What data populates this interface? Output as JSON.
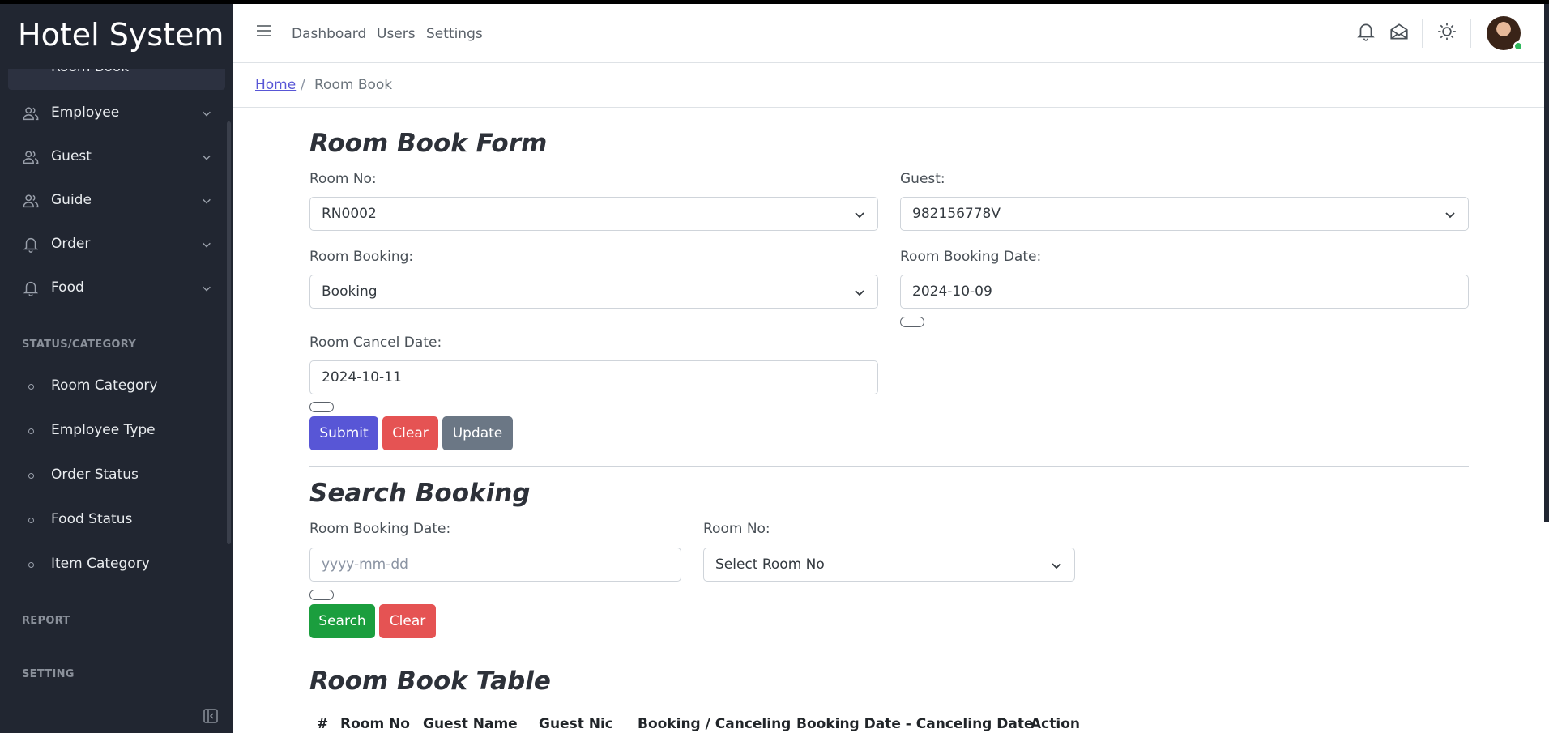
{
  "app": {
    "title": "Hotel System"
  },
  "sidebar": {
    "items": [
      {
        "label": "Room Book",
        "icon": "circle-dot-icon",
        "active": true
      },
      {
        "label": "Employee",
        "icon": "users-icon"
      },
      {
        "label": "Guest",
        "icon": "users-icon"
      },
      {
        "label": "Guide",
        "icon": "users-icon"
      },
      {
        "label": "Order",
        "icon": "bell-icon"
      },
      {
        "label": "Food",
        "icon": "bell-icon"
      }
    ],
    "section_status": "STATUS/CATEGORY",
    "status_items": [
      {
        "label": "Room Category"
      },
      {
        "label": "Employee Type"
      },
      {
        "label": "Order Status"
      },
      {
        "label": "Food Status"
      },
      {
        "label": "Item Category"
      }
    ],
    "section_report": "REPORT",
    "section_setting": "SETTING"
  },
  "header": {
    "nav": [
      "Dashboard",
      "Users",
      "Settings"
    ],
    "icons": [
      "menu-icon",
      "bell-icon",
      "envelope-icon",
      "sun-icon",
      "avatar"
    ]
  },
  "breadcrumb": {
    "home": "Home",
    "separator": "/",
    "current": "Room Book"
  },
  "form": {
    "title": "Room Book Form",
    "room_no_label": "Room No:",
    "room_no_value": "RN0002",
    "guest_label": "Guest:",
    "guest_value": "982156778V",
    "room_booking_label": "Room Booking:",
    "room_booking_value": "Booking",
    "booking_date_label": "Room Booking Date:",
    "booking_date_value": "2024-10-09",
    "cancel_date_label": "Room Cancel Date:",
    "cancel_date_value": "2024-10-11",
    "submit_label": "Submit",
    "clear_label": "Clear",
    "update_label": "Update"
  },
  "search": {
    "title": "Search Booking",
    "date_label": "Room Booking Date:",
    "date_placeholder": "yyyy-mm-dd",
    "room_label": "Room No:",
    "room_value": "Select Room No",
    "search_label": "Search",
    "clear_label": "Clear"
  },
  "table": {
    "title": "Room Book Table",
    "headers": [
      "#",
      "Room No",
      "Guest Name",
      "Guest Nic",
      "Booking / Canceling",
      "Booking Date - Canceling Date",
      "Action"
    ]
  },
  "colors": {
    "sidebar_bg": "#212631",
    "primary": "#5856d6",
    "danger": "#e55353",
    "secondary": "#6b7785",
    "success": "#1b9e3e"
  }
}
